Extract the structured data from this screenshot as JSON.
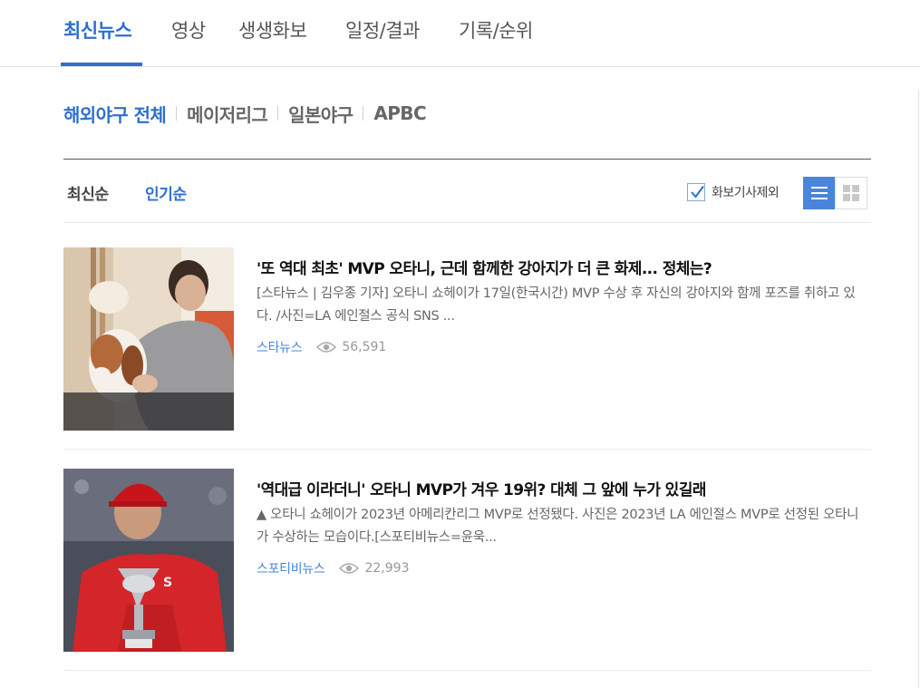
{
  "top_tabs": [
    {
      "label": "최신뉴스",
      "active": true
    },
    {
      "label": "영상",
      "active": false
    },
    {
      "label": "생생화보",
      "active": false
    },
    {
      "label": "일정/결과",
      "active": false
    },
    {
      "label": "기록/순위",
      "active": false
    }
  ],
  "sub_nav": [
    {
      "label": "해외야구 전체",
      "active": true
    },
    {
      "label": "메이저리그",
      "active": false
    },
    {
      "label": "일본야구",
      "active": false
    },
    {
      "label": "APBC",
      "active": false
    }
  ],
  "sort": [
    {
      "label": "최신순",
      "active": false
    },
    {
      "label": "인기순",
      "active": true
    }
  ],
  "filter": {
    "exclude_photo_label": "화보기사제외",
    "checked": true
  },
  "view_toggle": {
    "list_icon": "list-icon",
    "grid_icon": "grid-icon",
    "active": "list"
  },
  "colors": {
    "accent": "#2e6fd0",
    "list_button": "#4a84db"
  },
  "articles": [
    {
      "title": "'또 역대 최초' MVP 오타니, 근데 함께한 강아지가 더 큰 화제... 정체는?",
      "summary": "[스타뉴스 | 김우종 기자] 오타니 쇼헤이가 17일(한국시간) MVP 수상 후 자신의 강아지와 함께 포즈를 취하고 있다. /사진=LA 에인절스 공식 SNS ...",
      "source": "스타뉴스",
      "views": "56,591",
      "eye_icon": "eye-icon"
    },
    {
      "title": "'역대급 이라더니' 오타니 MVP가 겨우 19위? 대체 그 앞에 누가 있길래",
      "summary": "▲ 오타니 쇼헤이가 2023년 아메리칸리그 MVP로 선정됐다. 사진은 2023년 LA 에인절스 MVP로 선정된 오타니가 수상하는 모습이다.[스포티비뉴스=윤욱...",
      "source": "스포티비뉴스",
      "views": "22,993",
      "eye_icon": "eye-icon"
    }
  ]
}
